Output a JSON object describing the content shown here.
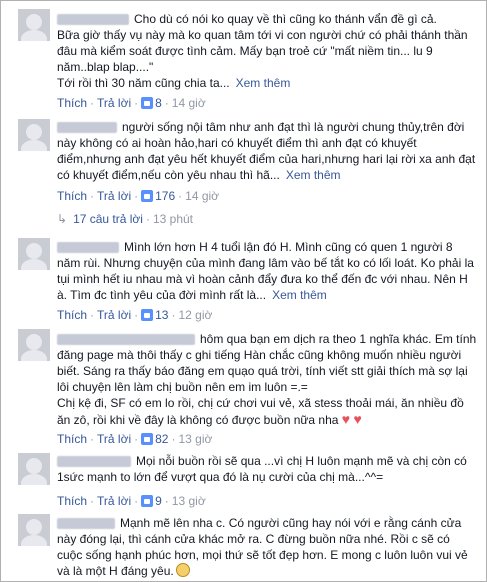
{
  "actions": {
    "like": "Thích",
    "reply": "Trả lời",
    "see_more": "Xem thêm"
  },
  "comments": [
    {
      "text": "Cho dù có nói ko quay về thì cũng ko thánh vẩn đề gì cả.\nBữa giờ thấy vụ này mà ko quan tâm tới vi con người chứ có phải thánh thần đâu mà kiểm soát được tình cảm. Mấy bạn troẻ cứ \"mất niềm tin... lu 9 năm..blap blap....\"\nTới rồi thì 30 năm cũng chia ta...",
      "likes": "8",
      "time": "14 giờ"
    },
    {
      "text": "người sống nội tâm như anh đạt thì là người chung thủy,trên đời này không có ai hoàn hảo,hari có khuyết điểm thì anh đạt có khuyết điểm,nhưng anh đạt yêu hết khuyết điểm của hari,nhưng hari lại rời xa anh đạt có khuyết điểm,nếu còn yêu nhau thì hã...",
      "likes": "176",
      "time": "14 giờ"
    },
    {
      "text": "Mình lớn hơn H 4 tuổi lận đó H. Mình cũng có quen 1 người 8 năm rùi. Nhưng chuyện của mình đang lâm vào bế tắt ko có lối loát. Ko phải la tụi mình hết iu nhau mà vì hoàn cảnh đẩy đưa ko thể đến đc với nhau. Nên H à. Tìm đc tình yêu của đời mình rất là...",
      "likes": "13",
      "time": "12 giờ"
    },
    {
      "text": "hôm qua bạn em dịch ra theo 1 nghĩa khác. Em tính đăng page mà thôi thấy c ghi tiếng Hàn chắc cũng không muốn nhiều người biết. Sáng ra thấy báo đăng em quạo quá trời, tính viết stt giải thích mà sợ lại lôi chuyện lên làm chị buồn nên em im luôn =.=\nChị kệ đi, SF có em lo rồi, chị cứ chơi vui vẻ, xã stess thoải mái, ăn nhiều đồ ăn zô, rồi khi về đây là không có được buồn nữa nha",
      "likes": "82",
      "time": "13 giờ"
    },
    {
      "text": "Mọi nỗi buồn rồi sẽ qua ...vì chị H luôn mạnh mẽ và chị còn có 1sức mạnh to lớn để vượt qua đó là nụ cười của chị mà...^^=",
      "likes": "9",
      "time": "13 giờ"
    },
    {
      "text": "Mạnh mẽ lên nha c. Có người cũng hay nói với e rằng cánh cửa này đóng lại, thì cánh cửa khác mở ra. C đừng buồn nữa nhé. Rồi c sẽ có cuộc sống hạnh phúc hơn, mọi thứ sẽ tốt đẹp hơn. E mong c luôn luôn vui vẻ và là một H đáng yêu."
    }
  ],
  "reply_summary": {
    "text": "17 câu trả lời",
    "time": "13 phút"
  }
}
